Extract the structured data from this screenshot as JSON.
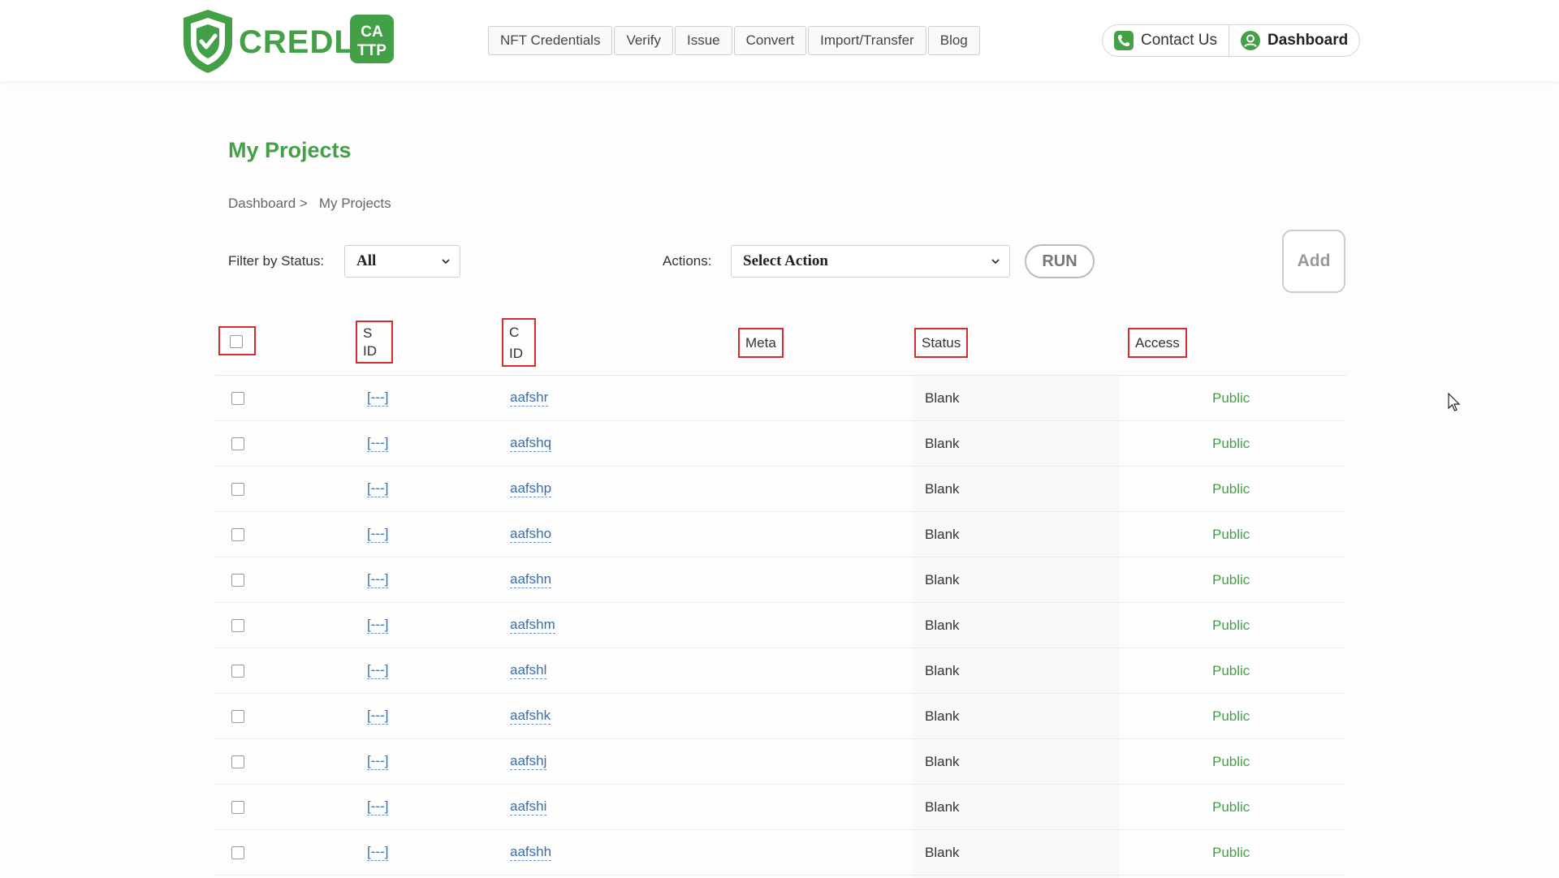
{
  "brand": {
    "name": "CREDLY",
    "badge_line1": "CA",
    "badge_line2": "TTP",
    "primary_color": "#43a047",
    "accent_color": "#3b6ea8",
    "highlight_color": "#d32f2f"
  },
  "nav": {
    "items": [
      "NFT Credentials",
      "Verify",
      "Issue",
      "Convert",
      "Import/Transfer",
      "Blog"
    ]
  },
  "header": {
    "contact_label": "Contact Us",
    "contact_icon": "phone-icon",
    "dashboard_label": "Dashboard",
    "dashboard_icon": "user-icon"
  },
  "page": {
    "title": "My Projects",
    "breadcrumb": [
      "Dashboard >",
      "My Projects"
    ]
  },
  "filters": {
    "status_label": "Filter by Status:",
    "status_value": "All",
    "actions_label": "Actions:",
    "action_value": "Select Action",
    "run_label": "RUN",
    "add_label": "Add"
  },
  "table": {
    "columns": {
      "sid_line1": "S",
      "sid_line2": "ID",
      "cid_line1": "C",
      "cid_line2": "ID",
      "meta": "Meta",
      "status": "Status",
      "access": "Access"
    },
    "rows": [
      {
        "sid": "[---]",
        "cid": "aafshr",
        "status": "Blank",
        "access": "Public"
      },
      {
        "sid": "[---]",
        "cid": "aafshq",
        "status": "Blank",
        "access": "Public"
      },
      {
        "sid": "[---]",
        "cid": "aafshp",
        "status": "Blank",
        "access": "Public"
      },
      {
        "sid": "[---]",
        "cid": "aafsho",
        "status": "Blank",
        "access": "Public"
      },
      {
        "sid": "[---]",
        "cid": "aafshn",
        "status": "Blank",
        "access": "Public"
      },
      {
        "sid": "[---]",
        "cid": "aafshm",
        "status": "Blank",
        "access": "Public"
      },
      {
        "sid": "[---]",
        "cid": "aafshl",
        "status": "Blank",
        "access": "Public"
      },
      {
        "sid": "[---]",
        "cid": "aafshk",
        "status": "Blank",
        "access": "Public"
      },
      {
        "sid": "[---]",
        "cid": "aafshj",
        "status": "Blank",
        "access": "Public"
      },
      {
        "sid": "[---]",
        "cid": "aafshi",
        "status": "Blank",
        "access": "Public"
      },
      {
        "sid": "[---]",
        "cid": "aafshh",
        "status": "Blank",
        "access": "Public"
      }
    ]
  }
}
